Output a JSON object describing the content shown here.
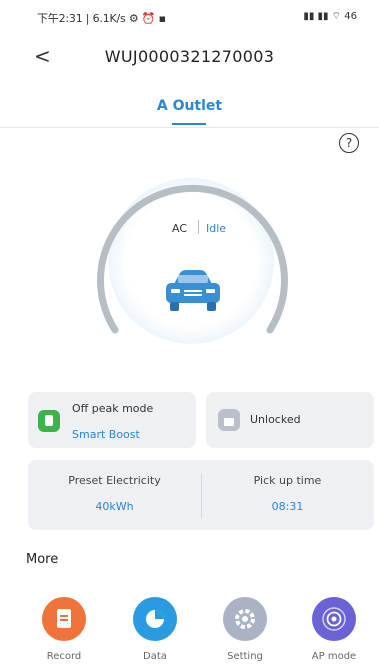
{
  "status_bar": {
    "left": "下午2:31 | 6.1K/s ⚙ ⏰ ▪",
    "right": "▮▮ ▮▮ ⌔ 46"
  },
  "header": {
    "back_icon": "chevron-left",
    "back_label": "<",
    "title": "WUJ0000321270003"
  },
  "tab": {
    "label": "A Outlet"
  },
  "help": {
    "label": "?"
  },
  "gauge": {
    "mode": "AC",
    "state": "Idle"
  },
  "off_peak": {
    "title": "Off peak mode",
    "value": "Smart Boost"
  },
  "lock": {
    "label": "Unlocked"
  },
  "preset": {
    "label": "Preset Electricity",
    "value": "40kWh"
  },
  "pickup": {
    "label": "Pick up time",
    "value": "08:31"
  },
  "more": {
    "title": "More"
  },
  "actions": [
    {
      "label": "Record",
      "icon": "record-icon",
      "color": "#f0733a"
    },
    {
      "label": "Data",
      "icon": "data-icon",
      "color": "#2b9be0"
    },
    {
      "label": "Setting",
      "icon": "gear-icon",
      "color": "#aab2c3"
    },
    {
      "label": "AP mode",
      "icon": "ap-mode-icon",
      "color": "#6b62d6"
    }
  ],
  "colors": {
    "accent": "#2a86d6",
    "green": "#3cb449"
  }
}
